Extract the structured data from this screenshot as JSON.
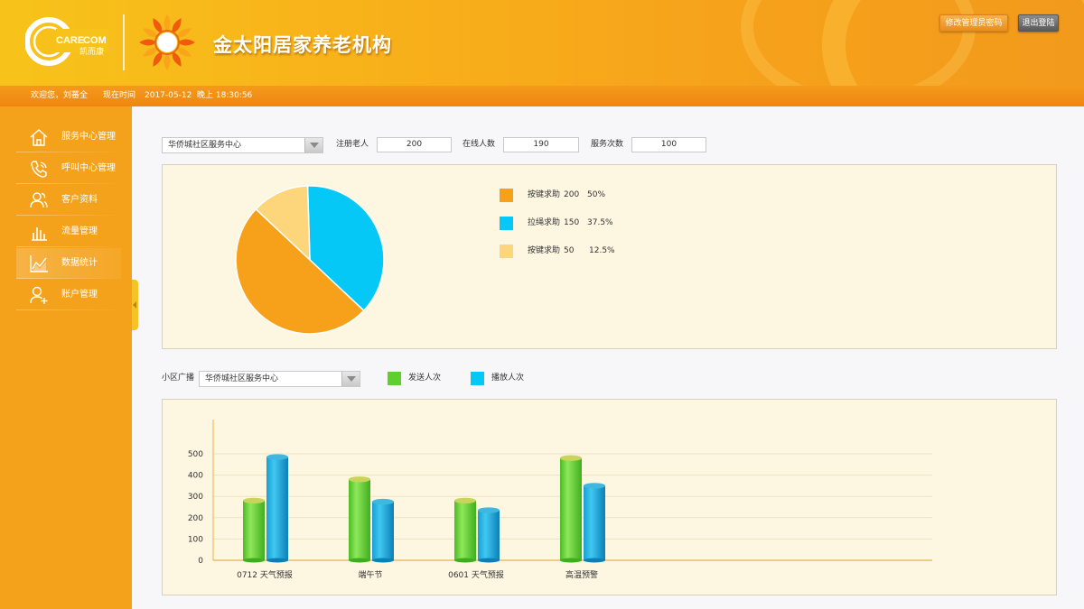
{
  "header": {
    "logo_text": "CARE COM",
    "logo_sub": "凯而康",
    "title": "金太阳居家养老机构",
    "change_password_label": "修改管理员密码",
    "logout_label": "退出登陆"
  },
  "statusbar": {
    "welcome": "欢迎您，刘蕃全",
    "time_label": "现在时间",
    "date": "2017-05-12",
    "time": "晚上 18:30:56"
  },
  "sidebar": {
    "items": [
      {
        "label": "服务中心管理",
        "icon": "home-icon"
      },
      {
        "label": "呼叫中心管理",
        "icon": "phone-icon"
      },
      {
        "label": "客户资料",
        "icon": "users-icon"
      },
      {
        "label": "流量管理",
        "icon": "bar-chart-icon"
      },
      {
        "label": "数据统计",
        "icon": "line-chart-icon",
        "active": true
      },
      {
        "label": "账户管理",
        "icon": "add-user-icon"
      }
    ]
  },
  "filters": {
    "center_select": "华侨城社区服务中心",
    "registered_label": "注册老人",
    "registered_value": "200",
    "online_label": "在线人数",
    "online_value": "190",
    "service_label": "服务次数",
    "service_value": "100"
  },
  "broadcast": {
    "label": "小区广播",
    "select": "华侨城社区服务中心",
    "legend_sent": "发送人次",
    "legend_played": "播放人次"
  },
  "colors": {
    "orange": "#f7a11a",
    "cyan": "#06c8f6",
    "light_yellow": "#fdd57a",
    "green": "#5fcf2e",
    "blue": "#17a7db"
  },
  "chart_data": [
    {
      "type": "pie",
      "slices": [
        {
          "label": "按键求助",
          "value": 200,
          "percent": "50%",
          "color": "#f7a11a"
        },
        {
          "label": "拉绳求助",
          "value": 150,
          "percent": "37.5%",
          "color": "#06c8f6"
        },
        {
          "label": "按键求助",
          "value": 50,
          "percent": "12.5%",
          "color": "#fdd57a"
        }
      ]
    },
    {
      "type": "bar",
      "categories": [
        "0712 天气预报",
        "端午节",
        "0601 天气预报",
        "高温预警"
      ],
      "series": [
        {
          "name": "发送人次",
          "values": [
            280,
            380,
            280,
            480
          ],
          "color": "#5fcf2e"
        },
        {
          "name": "播放人次",
          "values": [
            485,
            275,
            235,
            350
          ],
          "color": "#17a7db"
        }
      ],
      "yticks": [
        0,
        100,
        200,
        300,
        400,
        500
      ],
      "ylim": [
        0,
        500
      ]
    }
  ]
}
